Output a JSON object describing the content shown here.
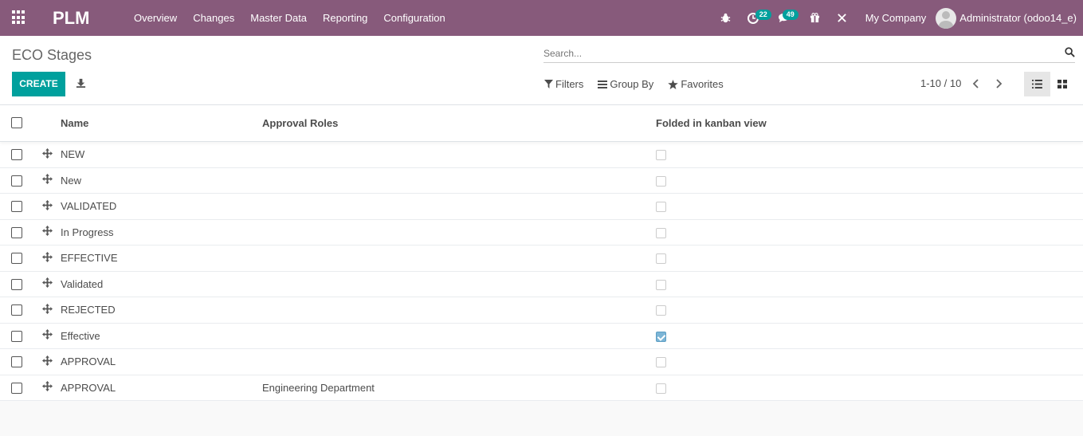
{
  "navbar": {
    "brand": "PLM",
    "menu": [
      "Overview",
      "Changes",
      "Master Data",
      "Reporting",
      "Configuration"
    ],
    "activity_count": "22",
    "messages_count": "49",
    "company": "My Company",
    "user": "Administrator (odoo14_e)"
  },
  "control_panel": {
    "title": "ECO Stages",
    "search_placeholder": "Search...",
    "create_label": "CREATE",
    "filters_label": "Filters",
    "group_by_label": "Group By",
    "favorites_label": "Favorites",
    "pager": "1-10 / 10"
  },
  "table": {
    "headers": {
      "name": "Name",
      "roles": "Approval Roles",
      "folded": "Folded in kanban view"
    },
    "rows": [
      {
        "name": "NEW",
        "roles": "",
        "folded": false
      },
      {
        "name": "New",
        "roles": "",
        "folded": false
      },
      {
        "name": "VALIDATED",
        "roles": "",
        "folded": false
      },
      {
        "name": "In Progress",
        "roles": "",
        "folded": false
      },
      {
        "name": "EFFECTIVE",
        "roles": "",
        "folded": false
      },
      {
        "name": "Validated",
        "roles": "",
        "folded": false
      },
      {
        "name": "REJECTED",
        "roles": "",
        "folded": false
      },
      {
        "name": "Effective",
        "roles": "",
        "folded": true
      },
      {
        "name": "APPROVAL",
        "roles": "",
        "folded": false
      },
      {
        "name": "APPROVAL",
        "roles": "Engineering Department",
        "folded": false
      }
    ]
  },
  "colors": {
    "navbar": "#875a7b",
    "primary": "#00a09d"
  }
}
